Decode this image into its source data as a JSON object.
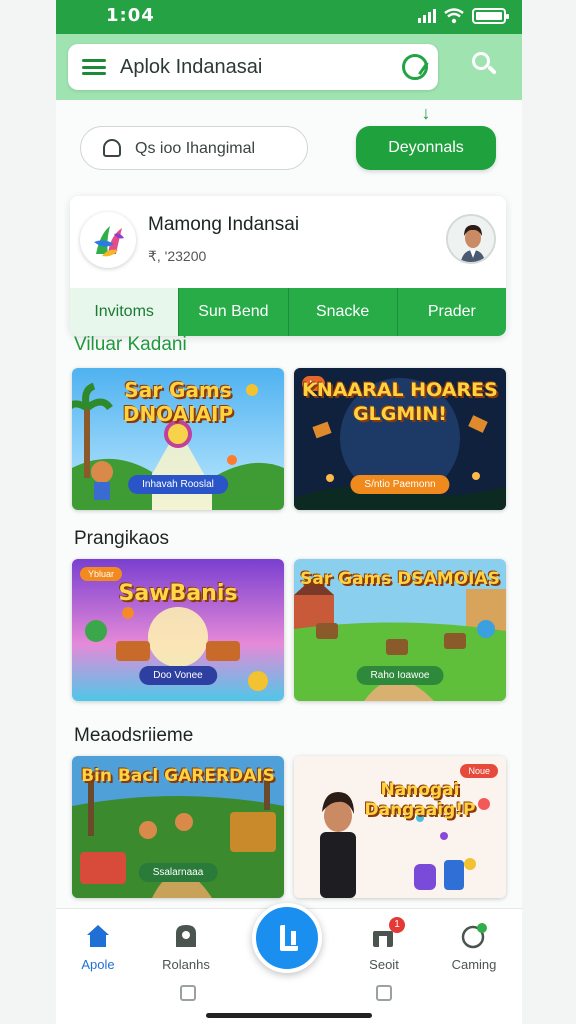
{
  "status_bar": {
    "time": "1:04"
  },
  "app_bar": {
    "title": "Aplok Indanasai"
  },
  "pill_search": {
    "placeholder": "Qs ioo Ihangimal"
  },
  "download_button": {
    "label": "Deyonnals"
  },
  "profile": {
    "name": "Mamong Indansai",
    "subtitle": "₹, '23200"
  },
  "tabs": [
    {
      "label": "Invitoms",
      "active": true
    },
    {
      "label": "Sun Bend",
      "active": false
    },
    {
      "label": "Snacke",
      "active": false
    },
    {
      "label": "Prader",
      "active": false
    }
  ],
  "sections": [
    {
      "title": "Viluar Kadani",
      "cards": [
        {
          "title": "Sar Gams DNOAIAIP",
          "cta": "Inhavah Rooslal"
        },
        {
          "title": "KNAARAL HOARES GLGMIN!",
          "cta": "S/ntio Paemonn"
        }
      ]
    },
    {
      "title": "Prangikaos",
      "cards": [
        {
          "title": "SawBanis",
          "tag": "Ybluar",
          "cta": "Doo Vonee"
        },
        {
          "title": "Sar Gams DSAMOIAS",
          "cta": "Raho Ioawoe"
        }
      ]
    },
    {
      "title": "Meaodsriieme",
      "cards": [
        {
          "title": "Bin Bacl GARERDAIS",
          "cta": "Ssalarnaaa"
        },
        {
          "title": "Nanogai Dangaaig!P",
          "tag": "Noue"
        }
      ]
    }
  ],
  "bottom_nav": [
    {
      "label": "Apole",
      "icon": "home-icon",
      "active": true
    },
    {
      "label": "Rolanhs",
      "icon": "user-icon",
      "active": false
    },
    {
      "label": "Seoit",
      "icon": "notification-icon",
      "active": false,
      "badge": "1"
    },
    {
      "label": "Caming",
      "icon": "game-icon",
      "active": false
    }
  ],
  "colors": {
    "brand_green": "#25a244",
    "accent_blue": "#1a8ff0",
    "app_bar": "#9fe3b0"
  }
}
